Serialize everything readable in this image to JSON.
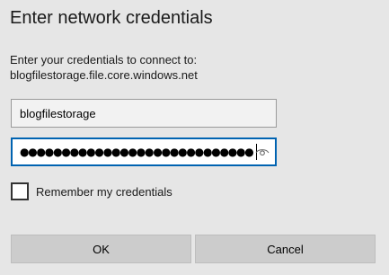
{
  "dialog": {
    "title": "Enter network credentials",
    "description_line1": "Enter your credentials to connect to:",
    "description_line2": "blogfilestorage.file.core.windows.net"
  },
  "username_field": {
    "value": "blogfilestorage"
  },
  "password_field": {
    "masked_value": "●●●●●●●●●●●●●●●●●●●●●●●●●●●●",
    "reveal_icon": "eye-icon"
  },
  "remember": {
    "label": "Remember my credentials",
    "checked": false
  },
  "buttons": {
    "ok_label": "OK",
    "cancel_label": "Cancel"
  },
  "colors": {
    "background": "#e6e6e6",
    "focus_border": "#0063b1",
    "button_bg": "#cccccc"
  }
}
